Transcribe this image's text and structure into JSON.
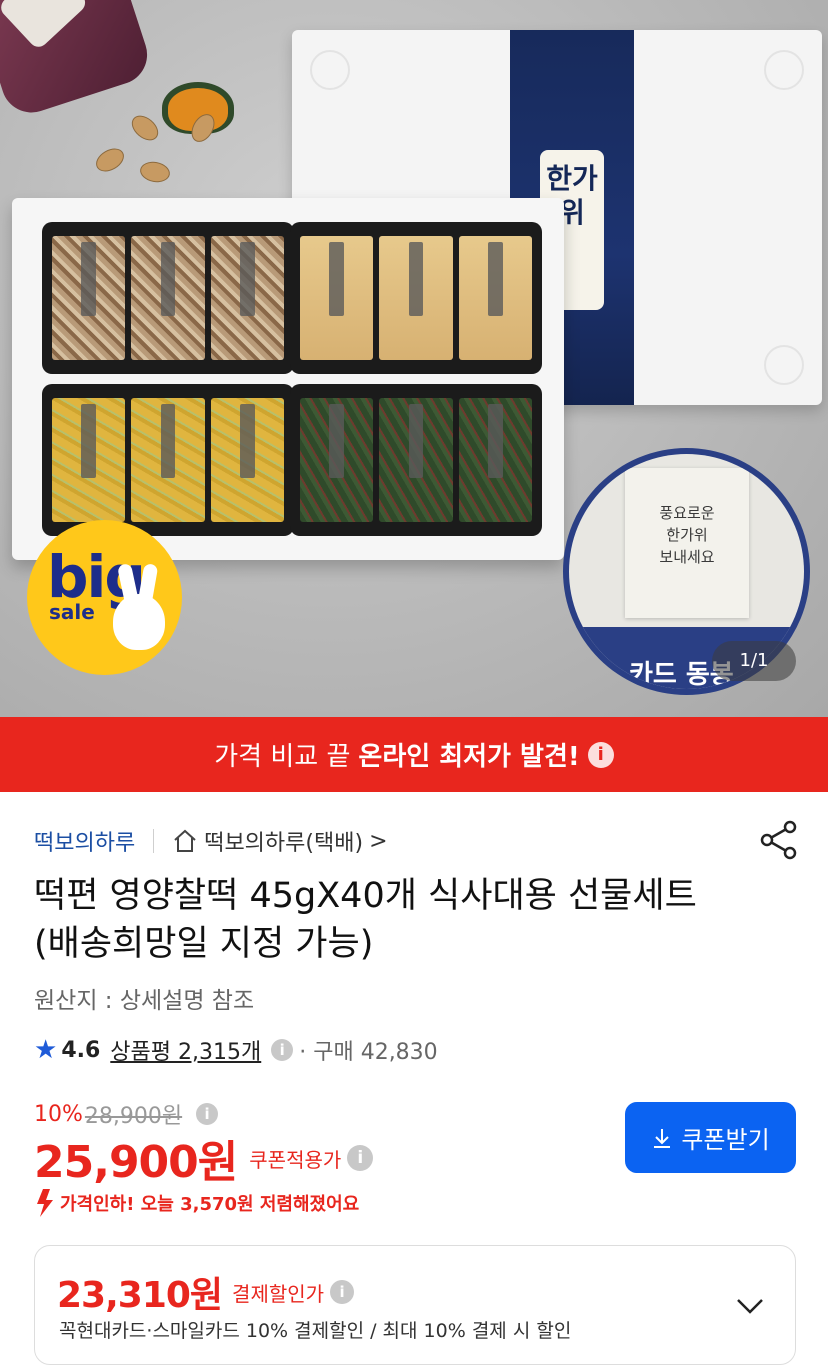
{
  "hero": {
    "band_label": "한가위",
    "card_lines": [
      "풍요로운",
      "한가위",
      "보내세요"
    ],
    "card_label": "카드 동봉",
    "image_counter": "1/1",
    "badge": {
      "big": "big",
      "sale": "sale",
      "color": "#ffc81a"
    }
  },
  "promo": {
    "text": "가격 비교 끝",
    "strong": "온라인 최저가 발견!",
    "info_icon": "info-icon",
    "color": "#e8261e"
  },
  "store": {
    "brand": "떡보의하루",
    "shop": "떡보의하루(택배)",
    "shop_chevron": ">",
    "home_icon": "home-icon",
    "share_icon": "share-icon"
  },
  "product": {
    "title": "떡편 영양찰떡 45gX40개 식사대용 선물세트 (배송희망일 지정 가능)",
    "origin": "원산지 : 상세설명 참조",
    "rating": "4.6",
    "reviews_label": "상품평 2,315개",
    "purchase_label": "· 구매 42,830"
  },
  "price": {
    "discount": "10%",
    "original": "28,900원",
    "current": "25,900원",
    "coupon_tag": "쿠폰적용가",
    "coupon_button": "쿠폰받기",
    "drop_note": "가격인하! 오늘 3,570원 저렴해졌어요",
    "accent": "#e8261e",
    "button_color": "#0b63f2"
  },
  "card_discount": {
    "price": "23,310원",
    "tag": "결제할인가",
    "desc": "꼭현대카드·스마일카드 10% 결제할인 / 최대 10% 결제 시 할인"
  }
}
